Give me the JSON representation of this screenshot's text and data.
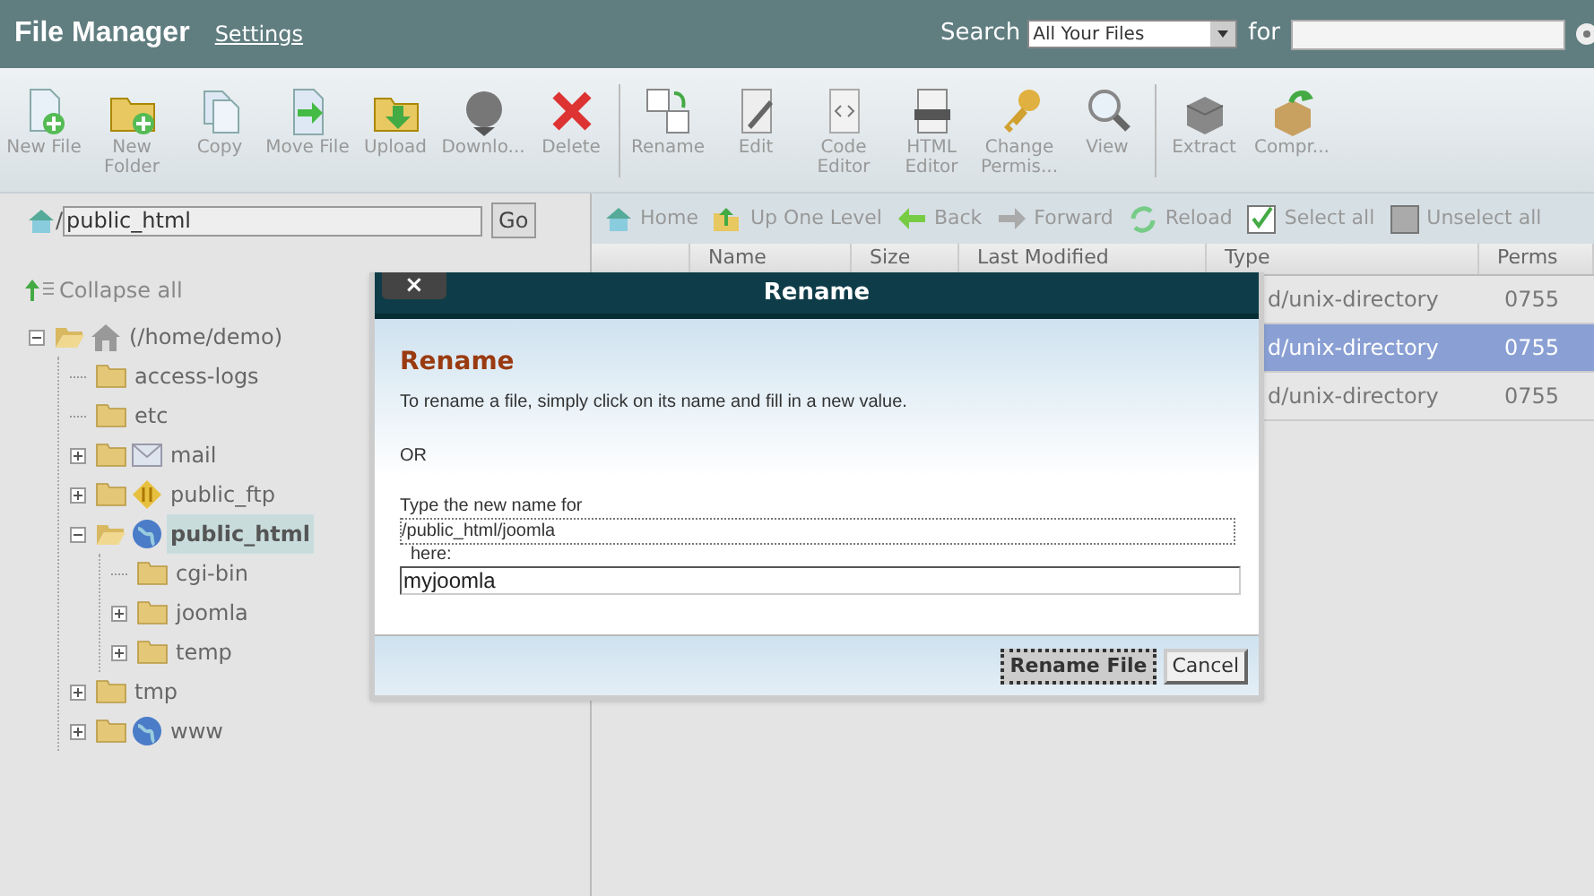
{
  "header": {
    "title": "File Manager",
    "settings_link": "Settings",
    "search_label": "Search",
    "search_scope": "All Your Files",
    "for_label": "for"
  },
  "toolbar_groups": [
    [
      {
        "label": "New File",
        "kind": "new-file"
      },
      {
        "label": "New Folder",
        "kind": "new-folder"
      },
      {
        "label": "Copy",
        "kind": "copy"
      },
      {
        "label": "Move File",
        "kind": "move"
      },
      {
        "label": "Upload",
        "kind": "upload"
      },
      {
        "label": "Downlo...",
        "kind": "download"
      },
      {
        "label": "Delete",
        "kind": "delete"
      }
    ],
    [
      {
        "label": "Rename",
        "kind": "rename"
      },
      {
        "label": "Edit",
        "kind": "edit"
      },
      {
        "label": "Code Editor",
        "kind": "code"
      },
      {
        "label": "HTML Editor",
        "kind": "html"
      },
      {
        "label": "Change Permis...",
        "kind": "key"
      },
      {
        "label": "View",
        "kind": "view"
      }
    ],
    [
      {
        "label": "Extract",
        "kind": "extract"
      },
      {
        "label": "Compr...",
        "kind": "compress"
      }
    ]
  ],
  "path_field": {
    "prefix": "/",
    "value": "public_html",
    "go": "Go"
  },
  "collapse_all": "Collapse all",
  "tree": [
    {
      "label": "(/home/demo)",
      "kind": "home",
      "expanded": true,
      "selected": false,
      "children": [
        {
          "label": "access-logs",
          "kind": "folder",
          "selected": false
        },
        {
          "label": "etc",
          "kind": "folder",
          "selected": false
        },
        {
          "label": "mail",
          "kind": "mail",
          "expanded": false,
          "selected": false
        },
        {
          "label": "public_ftp",
          "kind": "ftp",
          "expanded": false,
          "selected": false
        },
        {
          "label": "public_html",
          "kind": "globe",
          "expanded": true,
          "selected": true,
          "children": [
            {
              "label": "cgi-bin",
              "kind": "folder",
              "selected": false
            },
            {
              "label": "joomla",
              "kind": "folder",
              "expanded": false,
              "selected": false
            },
            {
              "label": "temp",
              "kind": "folder",
              "expanded": false,
              "selected": false
            }
          ]
        },
        {
          "label": "tmp",
          "kind": "folder",
          "expanded": false,
          "selected": false
        },
        {
          "label": "www",
          "kind": "globe",
          "expanded": false,
          "selected": false
        }
      ]
    }
  ],
  "nav": [
    {
      "label": "Home",
      "kind": "home"
    },
    {
      "label": "Up One Level",
      "kind": "up"
    },
    {
      "label": "Back",
      "kind": "back"
    },
    {
      "label": "Forward",
      "kind": "forward"
    },
    {
      "label": "Reload",
      "kind": "reload"
    },
    {
      "label": "Select all",
      "kind": "checked-box"
    },
    {
      "label": "Unselect all",
      "kind": "empty-box"
    }
  ],
  "table": {
    "columns": [
      "Name",
      "Size",
      "Last Modified",
      "Type",
      "Perms"
    ],
    "rows": [
      {
        "type": "d/unix-directory",
        "perms": "0755",
        "selected": false
      },
      {
        "type": "d/unix-directory",
        "perms": "0755",
        "selected": true
      },
      {
        "type": "d/unix-directory",
        "perms": "0755",
        "selected": false
      }
    ]
  },
  "dialog": {
    "title": "Rename",
    "close": "×",
    "heading": "Rename",
    "instructions": "To rename a file, simply click on its name and fill in a new value.",
    "or": "OR",
    "prompt": "Type the new name for",
    "path": "/public_html/joomla",
    "here": "here:",
    "value": "myjoomla",
    "buttons": [
      {
        "label": "Rename File",
        "primary": true
      },
      {
        "label": "Cancel",
        "primary": false
      }
    ]
  }
}
